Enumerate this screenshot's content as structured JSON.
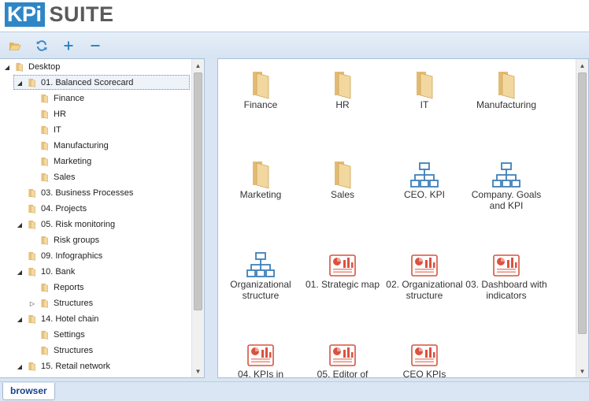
{
  "logo": {
    "brand_box": "KPi",
    "brand_text": "SUITE"
  },
  "toolbar": {
    "buttons": [
      {
        "name": "open-folder-button",
        "icon": "folder-open-icon"
      },
      {
        "name": "refresh-button",
        "icon": "refresh-icon"
      },
      {
        "name": "add-button",
        "icon": "plus-icon"
      },
      {
        "name": "remove-button",
        "icon": "minus-icon"
      }
    ]
  },
  "tree": {
    "items": [
      {
        "label": "Desktop",
        "level": 0,
        "arrow": "expanded",
        "selected": false
      },
      {
        "label": "01. Balanced Scorecard",
        "level": 1,
        "arrow": "expanded",
        "selected": true
      },
      {
        "label": "Finance",
        "level": 2,
        "arrow": "none",
        "selected": false
      },
      {
        "label": "HR",
        "level": 2,
        "arrow": "none",
        "selected": false
      },
      {
        "label": "IT",
        "level": 2,
        "arrow": "none",
        "selected": false
      },
      {
        "label": "Manufacturing",
        "level": 2,
        "arrow": "none",
        "selected": false
      },
      {
        "label": "Marketing",
        "level": 2,
        "arrow": "none",
        "selected": false
      },
      {
        "label": "Sales",
        "level": 2,
        "arrow": "none",
        "selected": false
      },
      {
        "label": "03. Business Processes",
        "level": 1,
        "arrow": "none",
        "selected": false
      },
      {
        "label": "04. Projects",
        "level": 1,
        "arrow": "none",
        "selected": false
      },
      {
        "label": "05. Risk monitoring",
        "level": 1,
        "arrow": "expanded",
        "selected": false
      },
      {
        "label": "Risk groups",
        "level": 2,
        "arrow": "none",
        "selected": false
      },
      {
        "label": "09. Infographics",
        "level": 1,
        "arrow": "none",
        "selected": false
      },
      {
        "label": "10. Bank",
        "level": 1,
        "arrow": "expanded",
        "selected": false
      },
      {
        "label": "Reports",
        "level": 2,
        "arrow": "none",
        "selected": false
      },
      {
        "label": "Structures",
        "level": 2,
        "arrow": "collapsed",
        "selected": false
      },
      {
        "label": "14. Hotel chain",
        "level": 1,
        "arrow": "expanded",
        "selected": false
      },
      {
        "label": "Settings",
        "level": 2,
        "arrow": "none",
        "selected": false
      },
      {
        "label": "Structures",
        "level": 2,
        "arrow": "none",
        "selected": false
      },
      {
        "label": "15. Retail network",
        "level": 1,
        "arrow": "expanded",
        "selected": false
      }
    ]
  },
  "content": {
    "tiles": [
      {
        "label": "Finance",
        "icon": "folder-icon"
      },
      {
        "label": "HR",
        "icon": "folder-icon"
      },
      {
        "label": "IT",
        "icon": "folder-icon"
      },
      {
        "label": "Manufacturing",
        "icon": "folder-icon"
      },
      {
        "label": "Marketing",
        "icon": "folder-icon"
      },
      {
        "label": "Sales",
        "icon": "folder-icon"
      },
      {
        "label": "CEO. KPI",
        "icon": "org-structure-icon"
      },
      {
        "label": "Company. Goals and KPI",
        "icon": "org-structure-icon"
      },
      {
        "label": "Organizational structure",
        "icon": "org-structure-icon"
      },
      {
        "label": "01. Strategic map",
        "icon": "dashboard-icon"
      },
      {
        "label": "02. Organizational structure",
        "icon": "dashboard-icon"
      },
      {
        "label": "03. Dashboard with indicators",
        "icon": "dashboard-icon"
      },
      {
        "label": "04. KPIs in",
        "icon": "dashboard-icon"
      },
      {
        "label": "05. Editor of",
        "icon": "dashboard-icon"
      },
      {
        "label": "CEO KPIs",
        "icon": "dashboard-icon"
      }
    ]
  },
  "bottom_tabs": [
    {
      "label": "browser"
    }
  ],
  "colors": {
    "brand_blue": "#2f86c6",
    "folder_tan": "#e9c98a",
    "org_blue": "#3d7fb8",
    "dashboard_red": "#d9533f",
    "tab_text": "#15428b"
  }
}
